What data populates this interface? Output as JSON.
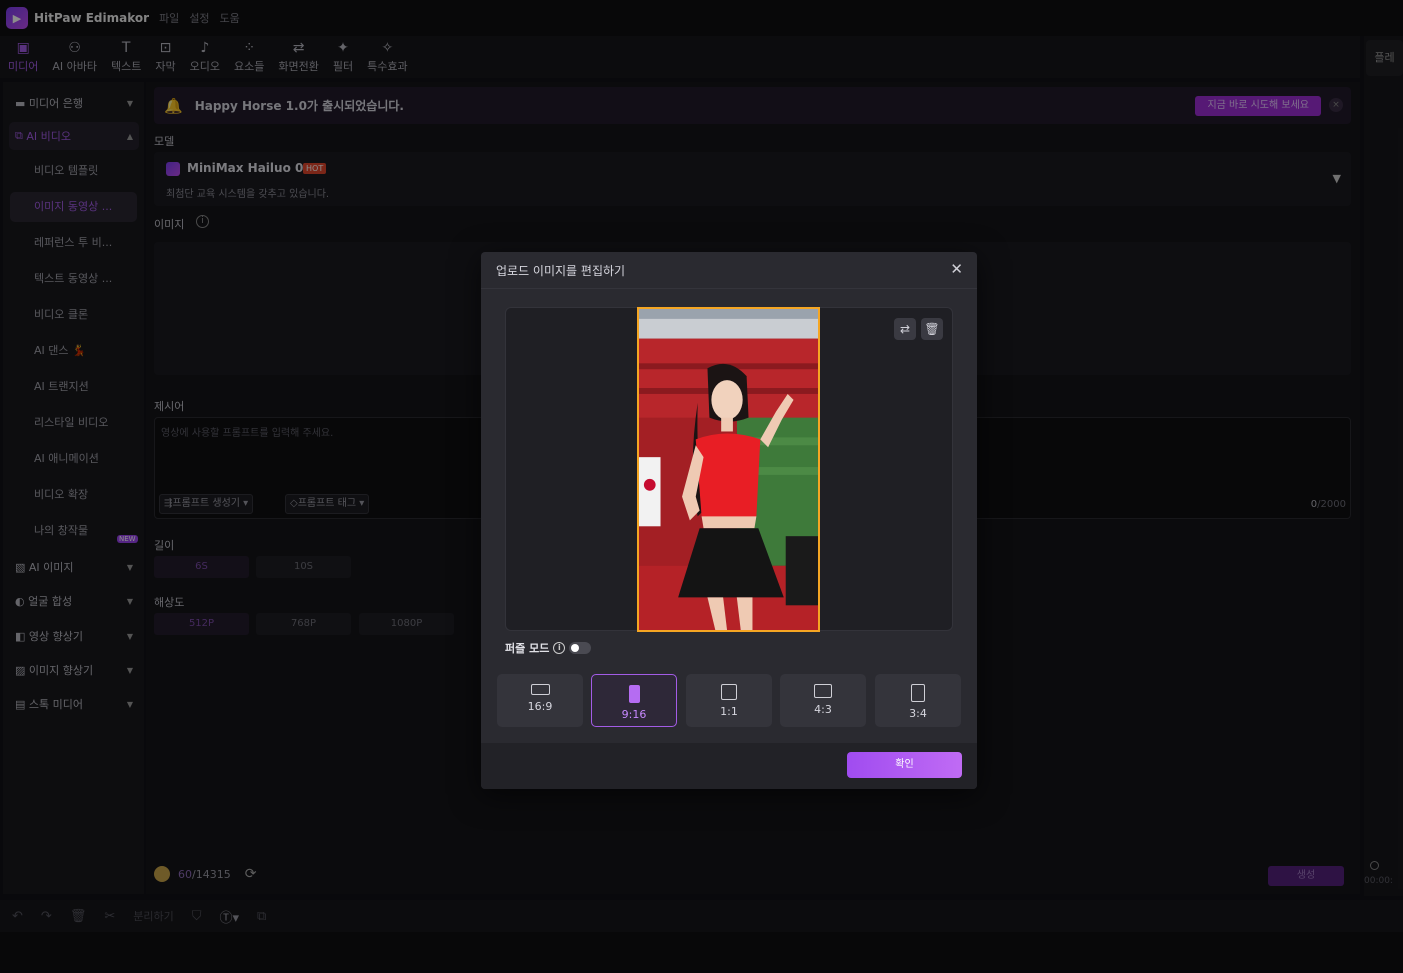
{
  "app": {
    "title": "HitPaw Edimakor",
    "menu": [
      "파일",
      "설정",
      "도움"
    ]
  },
  "toolbar": {
    "tools": [
      {
        "label": "미디어",
        "icon": "media-icon"
      },
      {
        "label": "AI 아바타",
        "icon": "avatar-icon"
      },
      {
        "label": "텍스트",
        "icon": "text-icon"
      },
      {
        "label": "자막",
        "icon": "subtitle-icon"
      },
      {
        "label": "오디오",
        "icon": "audio-icon"
      },
      {
        "label": "요소들",
        "icon": "elements-icon"
      },
      {
        "label": "화면전환",
        "icon": "transition-icon"
      },
      {
        "label": "필터",
        "icon": "filter-icon"
      },
      {
        "label": "특수효과",
        "icon": "effects-icon"
      }
    ],
    "right_tab": "플레"
  },
  "sidebar": {
    "groups": [
      {
        "label": "미디어 은행"
      },
      {
        "label": "AI 비디오"
      },
      {
        "label": "AI 이미지"
      },
      {
        "label": "얼굴 합성"
      },
      {
        "label": "영상 향상기"
      },
      {
        "label": "이미지 향상기"
      },
      {
        "label": "스톡 미디어"
      }
    ],
    "ai_video_items": [
      {
        "label": "비디오 템플릿"
      },
      {
        "label": "이미지 동영상 ..."
      },
      {
        "label": "레퍼런스 투 비..."
      },
      {
        "label": "텍스트 동영상 ..."
      },
      {
        "label": "비디오 클론"
      },
      {
        "label": "AI 댄스 💃"
      },
      {
        "label": "AI 트랜지션"
      },
      {
        "label": "리스타일 비디오"
      },
      {
        "label": "AI 애니메이션"
      },
      {
        "label": "비디오 확장"
      },
      {
        "label": "나의 창작물"
      }
    ],
    "new_badge": "NEW"
  },
  "banner": {
    "text": "Happy Horse 1.0가 출시되었습니다.",
    "button": "지금 바로 시도해 보세요",
    "close": "×"
  },
  "labels": {
    "model": "모델",
    "image": "이미지",
    "prompt": "제시어",
    "length": "길이",
    "resolution": "해상도"
  },
  "model": {
    "name": "MiniMax Hailuo 02",
    "badge": "HOT",
    "description": "최첨단 교육 시스템을 갖추고 있습니다."
  },
  "prompt": {
    "placeholder": "영상에 사용할 프롬프트를 입력해 주세요.",
    "generator_chip": "프롬프트 생성기",
    "tag_chip": "프롬프트 태그",
    "count_current": "0",
    "count_max": "/2000"
  },
  "length": {
    "options": [
      "6S",
      "10S"
    ],
    "selected": "6S"
  },
  "resolution": {
    "options": [
      "512P",
      "768P",
      "1080P"
    ],
    "selected": "512P"
  },
  "credits": {
    "used": "60",
    "total": "/14315"
  },
  "generate_button": "생성",
  "timeline": {
    "split_label": "분리하기",
    "time": "00:00:"
  },
  "modal": {
    "title": "업로드 이미지를 편집하기",
    "pro_mode_label": "퍼즐 모드",
    "pro_mode_on": false,
    "ratios": [
      {
        "label": "16:9"
      },
      {
        "label": "9:16"
      },
      {
        "label": "1:1"
      },
      {
        "label": "4:3"
      },
      {
        "label": "3:4"
      }
    ],
    "selected_ratio": "9:16",
    "confirm_label": "확인"
  },
  "colors": {
    "accent": "#a35ce6",
    "crop_border": "#f5a623",
    "banner_button": "#9d2fd6"
  }
}
